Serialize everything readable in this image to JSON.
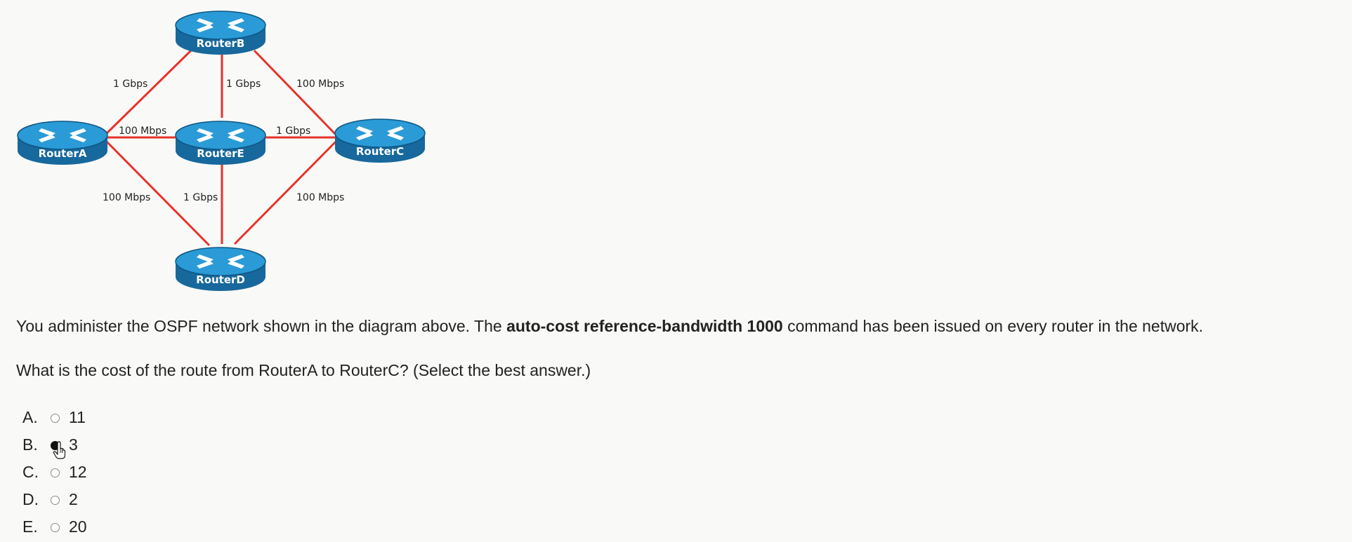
{
  "diagram": {
    "routers": [
      {
        "id": "b",
        "label": "RouterB"
      },
      {
        "id": "a",
        "label": "RouterA"
      },
      {
        "id": "e",
        "label": "RouterE"
      },
      {
        "id": "c",
        "label": "RouterC"
      },
      {
        "id": "d",
        "label": "RouterD"
      }
    ],
    "links": [
      {
        "from": "RouterA",
        "to": "RouterB",
        "bandwidth": "1 Gbps"
      },
      {
        "from": "RouterB",
        "to": "RouterE",
        "bandwidth": "1 Gbps"
      },
      {
        "from": "RouterB",
        "to": "RouterC",
        "bandwidth": "100 Mbps"
      },
      {
        "from": "RouterA",
        "to": "RouterE",
        "bandwidth": "100 Mbps"
      },
      {
        "from": "RouterE",
        "to": "RouterC",
        "bandwidth": "1 Gbps"
      },
      {
        "from": "RouterA",
        "to": "RouterD",
        "bandwidth": "100 Mbps"
      },
      {
        "from": "RouterE",
        "to": "RouterD",
        "bandwidth": "1 Gbps"
      },
      {
        "from": "RouterC",
        "to": "RouterD",
        "bandwidth": "100 Mbps"
      }
    ],
    "link_color": "#e8332a",
    "router_color": "#1d87c4"
  },
  "question": {
    "line1_prefix": "You administer the OSPF network shown in the diagram above. The ",
    "line1_bold": "auto-cost reference-bandwidth 1000",
    "line1_suffix": " command has been issued on every router in the network.",
    "line2": "What is the cost of the route from RouterA to RouterC?  (Select the best answer.)"
  },
  "options": [
    {
      "letter": "A.",
      "value": "11",
      "selected": false
    },
    {
      "letter": "B.",
      "value": "3",
      "selected": true
    },
    {
      "letter": "C.",
      "value": "12",
      "selected": false
    },
    {
      "letter": "D.",
      "value": "2",
      "selected": false
    },
    {
      "letter": "E.",
      "value": "20",
      "selected": false
    }
  ]
}
